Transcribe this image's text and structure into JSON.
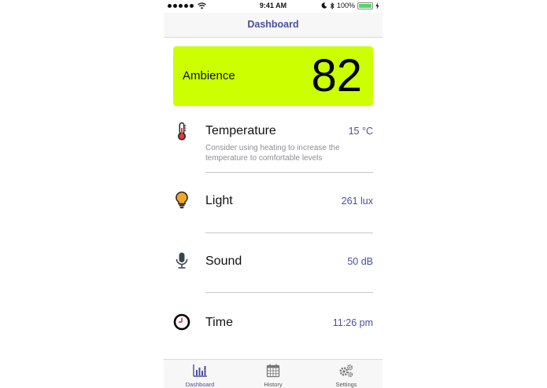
{
  "status_bar": {
    "time": "9:41 AM",
    "battery": "100%"
  },
  "nav": {
    "title": "Dashboard"
  },
  "ambience": {
    "label": "Ambience",
    "value": "82",
    "color": "#ccff00"
  },
  "metrics": [
    {
      "name": "Temperature",
      "value": "15 °C",
      "hint": "Consider using heating to increase the temperature to comfortable levels",
      "icon": "thermometer-icon"
    },
    {
      "name": "Light",
      "value": "261 lux",
      "icon": "light-bulb-icon"
    },
    {
      "name": "Sound",
      "value": "50 dB",
      "icon": "microphone-icon"
    },
    {
      "name": "Time",
      "value": "11:26 pm",
      "icon": "clock-icon"
    }
  ],
  "tabs": [
    {
      "label": "Dashboard",
      "icon": "bar-chart-icon",
      "active": true
    },
    {
      "label": "History",
      "icon": "calendar-icon",
      "active": false
    },
    {
      "label": "Settings",
      "icon": "gears-icon",
      "active": false
    }
  ],
  "accent_color": "#4b4f9c"
}
